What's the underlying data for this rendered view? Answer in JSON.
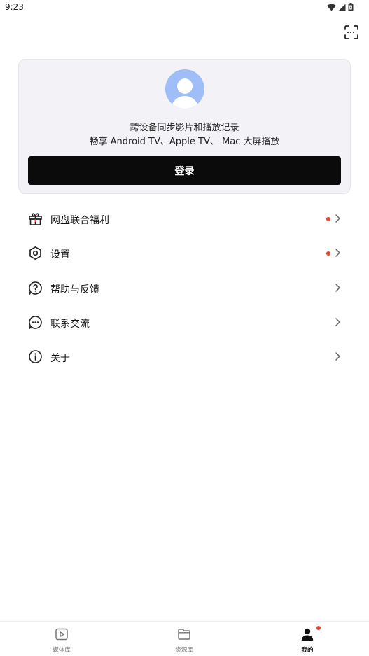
{
  "status_bar": {
    "time": "9:23",
    "icons": [
      "wifi-icon",
      "signal-icon",
      "battery-icon"
    ]
  },
  "header": {
    "scan_icon": "scan-icon"
  },
  "login_card": {
    "line1": "跨设备同步影片和播放记录",
    "line2": "畅享 Android TV、Apple TV、 Mac 大屏播放",
    "login_label": "登录",
    "avatar_color": "#9fbdf7"
  },
  "menu": {
    "items": [
      {
        "label": "网盘联合福利",
        "icon": "gift-icon",
        "badge": true
      },
      {
        "label": "设置",
        "icon": "settings-icon",
        "badge": true
      },
      {
        "label": "帮助与反馈",
        "icon": "help-icon",
        "badge": false
      },
      {
        "label": "联系交流",
        "icon": "chat-icon",
        "badge": false
      },
      {
        "label": "关于",
        "icon": "info-icon",
        "badge": false
      }
    ]
  },
  "bottom_nav": {
    "tabs": [
      {
        "label": "媒体库",
        "icon": "play-icon",
        "active": false
      },
      {
        "label": "资源库",
        "icon": "folder-icon",
        "active": false
      },
      {
        "label": "我的",
        "icon": "user-icon",
        "active": true
      }
    ]
  },
  "colors": {
    "accent_dot": "#e8442f",
    "button_bg": "#0b0b0b",
    "card_bg": "#f2f2f7"
  }
}
